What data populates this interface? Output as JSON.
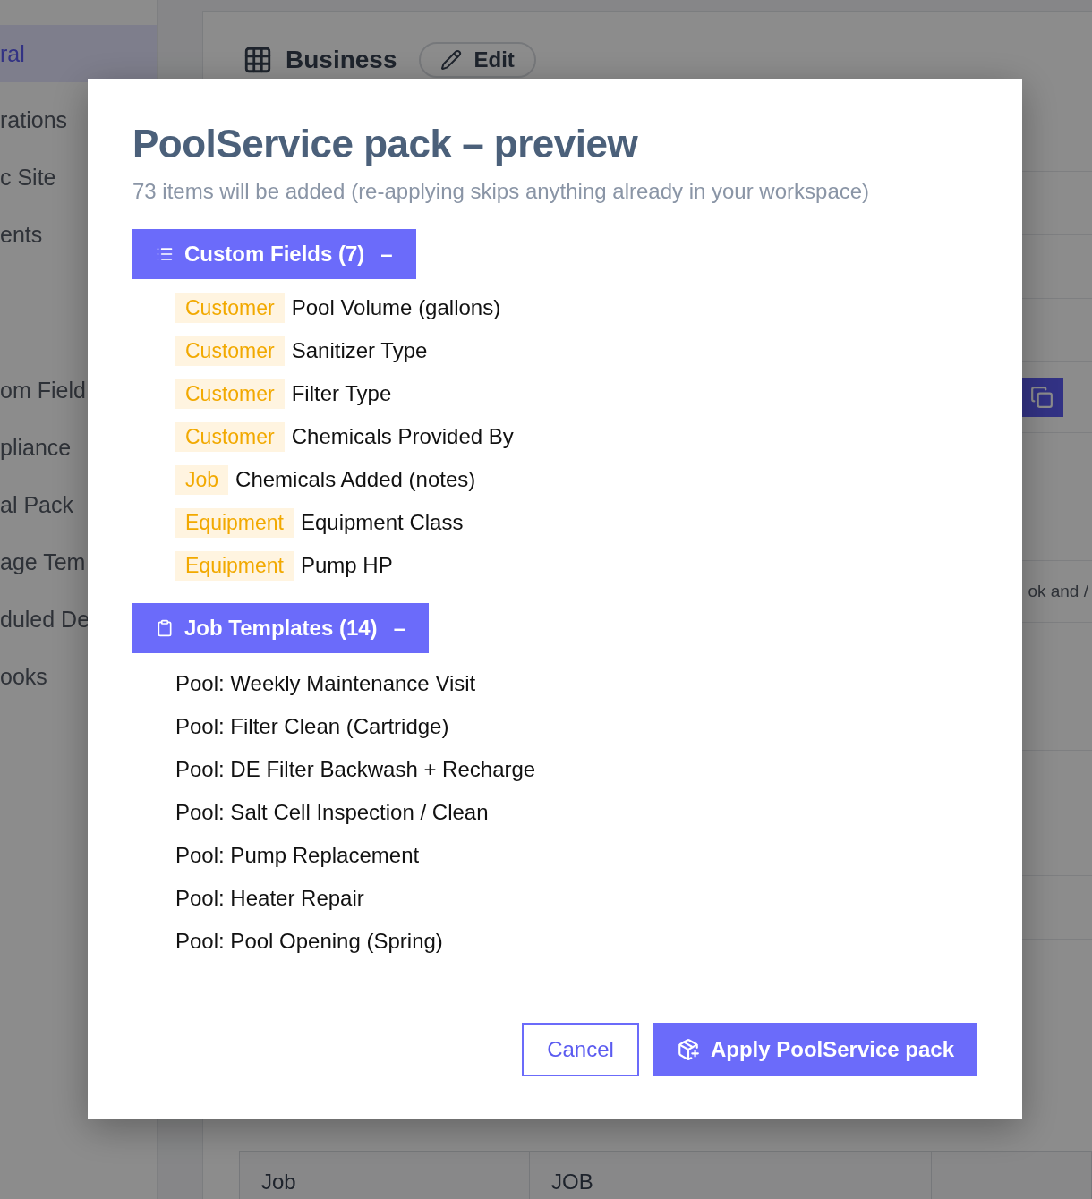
{
  "background": {
    "sidebar": {
      "items": [
        {
          "label": "ral",
          "selected": true
        },
        {
          "label": "rations",
          "selected": false
        },
        {
          "label": "c Site",
          "selected": false
        },
        {
          "label": "ents",
          "selected": false
        },
        {
          "label": "om Field",
          "selected": false
        },
        {
          "label": "pliance",
          "selected": false
        },
        {
          "label": "al Pack",
          "selected": false
        },
        {
          "label": "age Tem",
          "selected": false
        },
        {
          "label": "duled De",
          "selected": false
        },
        {
          "label": "ooks",
          "selected": false
        }
      ]
    },
    "header": {
      "title": "Business",
      "edit_button": "Edit"
    },
    "row_text": "ok and /",
    "table_row": {
      "label": "Job",
      "value": "JOB"
    }
  },
  "modal": {
    "title": "PoolService pack – preview",
    "subtitle": "73 items will be added (re-applying skips anything already in your workspace)",
    "sections": [
      {
        "kind": "fields",
        "title": "Custom Fields (7)",
        "toggle": "–",
        "expanded": true,
        "items": [
          {
            "tag": "Customer",
            "label": "Pool Volume (gallons)"
          },
          {
            "tag": "Customer",
            "label": "Sanitizer Type"
          },
          {
            "tag": "Customer",
            "label": "Filter Type"
          },
          {
            "tag": "Customer",
            "label": "Chemicals Provided By"
          },
          {
            "tag": "Job",
            "label": "Chemicals Added (notes)"
          },
          {
            "tag": "Equipment",
            "label": "Equipment Class"
          },
          {
            "tag": "Equipment",
            "label": "Pump HP"
          }
        ]
      },
      {
        "kind": "templates",
        "title": "Job Templates (14)",
        "toggle": "–",
        "expanded": true,
        "items": [
          {
            "label": "Pool: Weekly Maintenance Visit"
          },
          {
            "label": "Pool: Filter Clean (Cartridge)"
          },
          {
            "label": "Pool: DE Filter Backwash + Recharge"
          },
          {
            "label": "Pool: Salt Cell Inspection / Clean"
          },
          {
            "label": "Pool: Pump Replacement"
          },
          {
            "label": "Pool: Heater Repair"
          },
          {
            "label": "Pool: Pool Opening (Spring)"
          }
        ]
      }
    ],
    "buttons": {
      "cancel": "Cancel",
      "apply": "Apply PoolService pack"
    }
  }
}
